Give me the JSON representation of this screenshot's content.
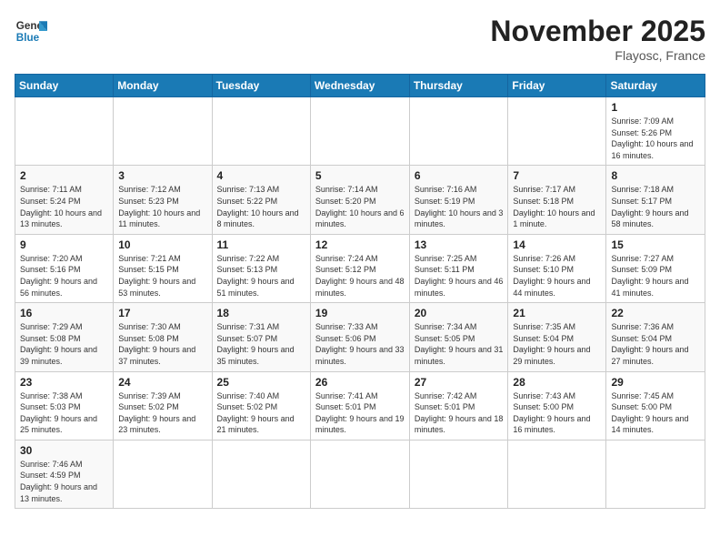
{
  "header": {
    "logo_general": "General",
    "logo_blue": "Blue",
    "month_title": "November 2025",
    "location": "Flayosc, France"
  },
  "weekdays": [
    "Sunday",
    "Monday",
    "Tuesday",
    "Wednesday",
    "Thursday",
    "Friday",
    "Saturday"
  ],
  "weeks": [
    [
      {
        "day": "",
        "info": ""
      },
      {
        "day": "",
        "info": ""
      },
      {
        "day": "",
        "info": ""
      },
      {
        "day": "",
        "info": ""
      },
      {
        "day": "",
        "info": ""
      },
      {
        "day": "",
        "info": ""
      },
      {
        "day": "1",
        "info": "Sunrise: 7:09 AM\nSunset: 5:26 PM\nDaylight: 10 hours and 16 minutes."
      }
    ],
    [
      {
        "day": "2",
        "info": "Sunrise: 7:11 AM\nSunset: 5:24 PM\nDaylight: 10 hours and 13 minutes."
      },
      {
        "day": "3",
        "info": "Sunrise: 7:12 AM\nSunset: 5:23 PM\nDaylight: 10 hours and 11 minutes."
      },
      {
        "day": "4",
        "info": "Sunrise: 7:13 AM\nSunset: 5:22 PM\nDaylight: 10 hours and 8 minutes."
      },
      {
        "day": "5",
        "info": "Sunrise: 7:14 AM\nSunset: 5:20 PM\nDaylight: 10 hours and 6 minutes."
      },
      {
        "day": "6",
        "info": "Sunrise: 7:16 AM\nSunset: 5:19 PM\nDaylight: 10 hours and 3 minutes."
      },
      {
        "day": "7",
        "info": "Sunrise: 7:17 AM\nSunset: 5:18 PM\nDaylight: 10 hours and 1 minute."
      },
      {
        "day": "8",
        "info": "Sunrise: 7:18 AM\nSunset: 5:17 PM\nDaylight: 9 hours and 58 minutes."
      }
    ],
    [
      {
        "day": "9",
        "info": "Sunrise: 7:20 AM\nSunset: 5:16 PM\nDaylight: 9 hours and 56 minutes."
      },
      {
        "day": "10",
        "info": "Sunrise: 7:21 AM\nSunset: 5:15 PM\nDaylight: 9 hours and 53 minutes."
      },
      {
        "day": "11",
        "info": "Sunrise: 7:22 AM\nSunset: 5:13 PM\nDaylight: 9 hours and 51 minutes."
      },
      {
        "day": "12",
        "info": "Sunrise: 7:24 AM\nSunset: 5:12 PM\nDaylight: 9 hours and 48 minutes."
      },
      {
        "day": "13",
        "info": "Sunrise: 7:25 AM\nSunset: 5:11 PM\nDaylight: 9 hours and 46 minutes."
      },
      {
        "day": "14",
        "info": "Sunrise: 7:26 AM\nSunset: 5:10 PM\nDaylight: 9 hours and 44 minutes."
      },
      {
        "day": "15",
        "info": "Sunrise: 7:27 AM\nSunset: 5:09 PM\nDaylight: 9 hours and 41 minutes."
      }
    ],
    [
      {
        "day": "16",
        "info": "Sunrise: 7:29 AM\nSunset: 5:08 PM\nDaylight: 9 hours and 39 minutes."
      },
      {
        "day": "17",
        "info": "Sunrise: 7:30 AM\nSunset: 5:08 PM\nDaylight: 9 hours and 37 minutes."
      },
      {
        "day": "18",
        "info": "Sunrise: 7:31 AM\nSunset: 5:07 PM\nDaylight: 9 hours and 35 minutes."
      },
      {
        "day": "19",
        "info": "Sunrise: 7:33 AM\nSunset: 5:06 PM\nDaylight: 9 hours and 33 minutes."
      },
      {
        "day": "20",
        "info": "Sunrise: 7:34 AM\nSunset: 5:05 PM\nDaylight: 9 hours and 31 minutes."
      },
      {
        "day": "21",
        "info": "Sunrise: 7:35 AM\nSunset: 5:04 PM\nDaylight: 9 hours and 29 minutes."
      },
      {
        "day": "22",
        "info": "Sunrise: 7:36 AM\nSunset: 5:04 PM\nDaylight: 9 hours and 27 minutes."
      }
    ],
    [
      {
        "day": "23",
        "info": "Sunrise: 7:38 AM\nSunset: 5:03 PM\nDaylight: 9 hours and 25 minutes."
      },
      {
        "day": "24",
        "info": "Sunrise: 7:39 AM\nSunset: 5:02 PM\nDaylight: 9 hours and 23 minutes."
      },
      {
        "day": "25",
        "info": "Sunrise: 7:40 AM\nSunset: 5:02 PM\nDaylight: 9 hours and 21 minutes."
      },
      {
        "day": "26",
        "info": "Sunrise: 7:41 AM\nSunset: 5:01 PM\nDaylight: 9 hours and 19 minutes."
      },
      {
        "day": "27",
        "info": "Sunrise: 7:42 AM\nSunset: 5:01 PM\nDaylight: 9 hours and 18 minutes."
      },
      {
        "day": "28",
        "info": "Sunrise: 7:43 AM\nSunset: 5:00 PM\nDaylight: 9 hours and 16 minutes."
      },
      {
        "day": "29",
        "info": "Sunrise: 7:45 AM\nSunset: 5:00 PM\nDaylight: 9 hours and 14 minutes."
      }
    ],
    [
      {
        "day": "30",
        "info": "Sunrise: 7:46 AM\nSunset: 4:59 PM\nDaylight: 9 hours and 13 minutes."
      },
      {
        "day": "",
        "info": ""
      },
      {
        "day": "",
        "info": ""
      },
      {
        "day": "",
        "info": ""
      },
      {
        "day": "",
        "info": ""
      },
      {
        "day": "",
        "info": ""
      },
      {
        "day": "",
        "info": ""
      }
    ]
  ]
}
